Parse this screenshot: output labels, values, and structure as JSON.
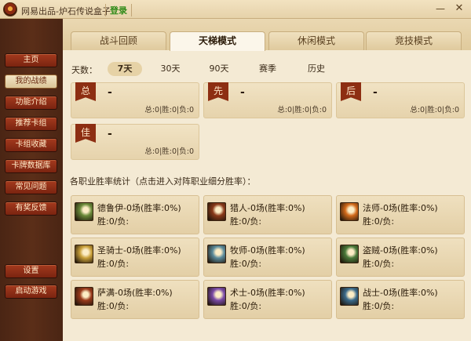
{
  "window": {
    "title": "网易出品-炉石传说盒子",
    "login_label": "登录",
    "minimize_symbol": "—",
    "close_symbol": "✕"
  },
  "sidebar": {
    "items": [
      {
        "label": "主页",
        "active": false
      },
      {
        "label": "我的战绩",
        "active": true
      },
      {
        "label": "功能介绍",
        "active": false
      },
      {
        "label": "推荐卡组",
        "active": false
      },
      {
        "label": "卡组收藏",
        "active": false
      },
      {
        "label": "卡牌数据库",
        "active": false
      },
      {
        "label": "常见问题",
        "active": false
      },
      {
        "label": "有奖反馈",
        "active": false
      }
    ],
    "bottom_items": [
      {
        "label": "设置"
      },
      {
        "label": "启动游戏"
      }
    ]
  },
  "tabs": [
    {
      "label": "战斗回顾",
      "active": false
    },
    {
      "label": "天梯模式",
      "active": true
    },
    {
      "label": "休闲模式",
      "active": false
    },
    {
      "label": "竞技模式",
      "active": false
    }
  ],
  "days": {
    "label": "天数：",
    "options": [
      {
        "label": "7天",
        "active": true
      },
      {
        "label": "30天",
        "active": false
      },
      {
        "label": "90天",
        "active": false
      },
      {
        "label": "赛季",
        "active": false
      },
      {
        "label": "历史",
        "active": false
      }
    ]
  },
  "ranks": [
    {
      "badge": "总",
      "value": "-",
      "stats": "总:0|胜:0|负:0"
    },
    {
      "badge": "先",
      "value": "-",
      "stats": "总:0|胜:0|负:0"
    },
    {
      "badge": "后",
      "value": "-",
      "stats": "总:0|胜:0|负:0"
    },
    {
      "badge": "佳",
      "value": "-",
      "stats": "总:0|胜:0|负:0"
    }
  ],
  "class_section_title": "各职业胜率统计（点击进入对阵职业细分胜率）：",
  "classes": [
    {
      "name": "德鲁伊-0场(胜率:0%)",
      "sub": "胜:0/负:",
      "icon": "druid-icon",
      "color": "#6a8a3a"
    },
    {
      "name": "猎人-0场(胜率:0%)",
      "sub": "胜:0/负:",
      "icon": "hunter-icon",
      "color": "#8a3a1a"
    },
    {
      "name": "法师-0场(胜率:0%)",
      "sub": "胜:0/负:",
      "icon": "mage-icon",
      "color": "#d26a1a"
    },
    {
      "name": "圣骑士-0场(胜率:0%)",
      "sub": "胜:0/负:",
      "icon": "paladin-icon",
      "color": "#c9a03a"
    },
    {
      "name": "牧师-0场(胜率:0%)",
      "sub": "胜:0/负:",
      "icon": "priest-icon",
      "color": "#5a8a9a"
    },
    {
      "name": "盗贼-0场(胜率:0%)",
      "sub": "胜:0/负:",
      "icon": "rogue-icon",
      "color": "#4a7a3a"
    },
    {
      "name": "萨满-0场(胜率:0%)",
      "sub": "胜:0/负:",
      "icon": "shaman-icon",
      "color": "#9a3a1a"
    },
    {
      "name": "术士-0场(胜率:0%)",
      "sub": "胜:0/负:",
      "icon": "warlock-icon",
      "color": "#7a4aa6"
    },
    {
      "name": "战士-0场(胜率:0%)",
      "sub": "胜:0/负:",
      "icon": "warrior-icon",
      "color": "#3a6a8a"
    }
  ]
}
